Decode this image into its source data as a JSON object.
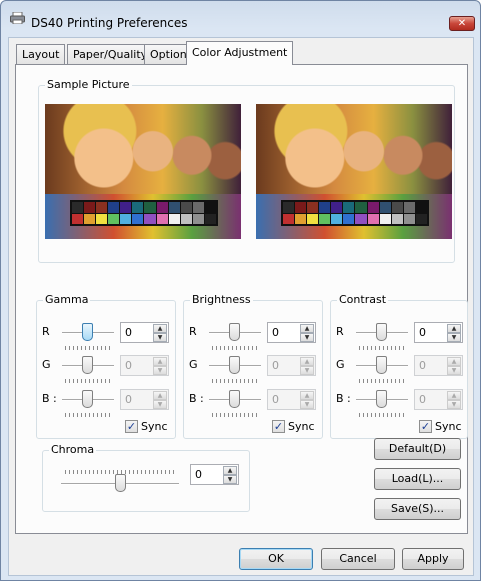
{
  "window": {
    "title": "DS40 Printing Preferences",
    "close_glyph": "✕",
    "icon": "printer-icon"
  },
  "tabs": [
    {
      "label": "Layout"
    },
    {
      "label": "Paper/Quality"
    },
    {
      "label": "Option"
    },
    {
      "label": "Color Adjustment",
      "active": true
    }
  ],
  "sample": {
    "label": "Sample Picture"
  },
  "groups": {
    "gamma": {
      "label": "Gamma",
      "r": "R",
      "g": "G",
      "b": "B :",
      "r_value": "0",
      "g_value": "0",
      "b_value": "0",
      "sync": "Sync"
    },
    "brightness": {
      "label": "Brightness",
      "r": "R",
      "g": "G",
      "b": "B :",
      "r_value": "0",
      "g_value": "0",
      "b_value": "0",
      "sync": "Sync"
    },
    "contrast": {
      "label": "Contrast",
      "r": "R",
      "g": "G",
      "b": "B :",
      "r_value": "0",
      "g_value": "0",
      "b_value": "0",
      "sync": "Sync"
    }
  },
  "chroma": {
    "label": "Chroma",
    "value": "0"
  },
  "side_buttons": {
    "default": "Default(D)",
    "load": "Load(L)...",
    "save": "Save(S)..."
  },
  "footer": {
    "ok": "OK",
    "cancel": "Cancel",
    "apply": "Apply"
  },
  "checkmark": "✓",
  "spin_up": "▲",
  "spin_down": "▼",
  "swatch_colors": [
    "#2a2a2a",
    "#7a1a1a",
    "#8a3020",
    "#20408a",
    "#40208a",
    "#1a6a7a",
    "#206040",
    "#7a1a6a",
    "#305070",
    "#4a4a4a",
    "#6a6a6a",
    "#111111",
    "#c03030",
    "#e0a030",
    "#f0e040",
    "#60c060",
    "#50b0e0",
    "#3070d0",
    "#9050c0",
    "#e070b0",
    "#f0f0f0",
    "#c0c0c0",
    "#909090",
    "#222222"
  ]
}
